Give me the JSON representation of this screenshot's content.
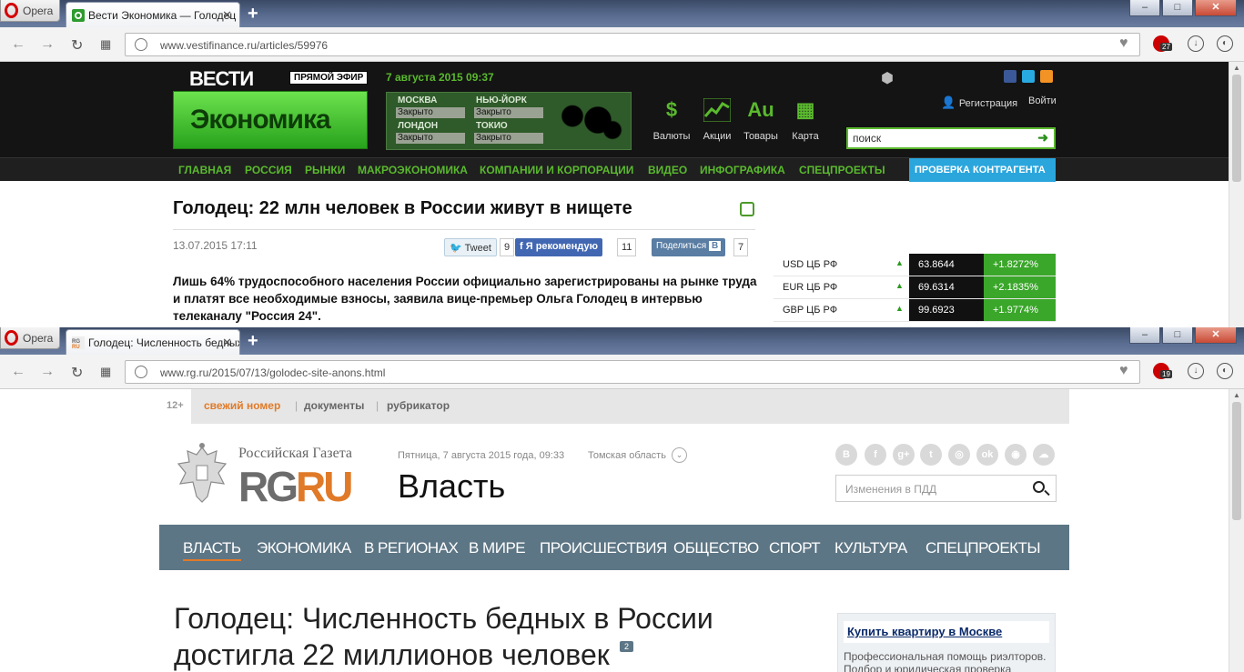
{
  "browser": {
    "menu_label": "Opera",
    "tab_menu": "▾",
    "new_tab": "+",
    "win_min": "–",
    "win_max": "□",
    "win_close": "✕"
  },
  "win1": {
    "tab_title": "Вести Экономика — Голодец",
    "url": "www.vestifinance.ru/articles/59976",
    "ext_badge": "27",
    "favicon_color": "#2e9b2e"
  },
  "win2": {
    "tab_title": "Голодец: Численность бедных",
    "url": "www.rg.ru/2015/07/13/golodec-site-anons.html",
    "ext_badge": "19"
  },
  "vesti": {
    "brand": "ВЕСТИ",
    "live": "ПРЯМОЙ ЭФИР",
    "date": "7 августа 2015 09:37",
    "logo": "Экономика",
    "markets": [
      {
        "city": "МОСКВА",
        "status": "Закрыто"
      },
      {
        "city": "НЬЮ-ЙОРК",
        "status": "Закрыто"
      },
      {
        "city": "ЛОНДОН",
        "status": "Закрыто"
      },
      {
        "city": "ТОКИО",
        "status": "Закрыто"
      }
    ],
    "quick": [
      {
        "icon": "$",
        "label": "Валюты"
      },
      {
        "icon": "📈",
        "label": "Акции"
      },
      {
        "icon": "Au",
        "label": "Товары"
      },
      {
        "icon": "▦",
        "label": "Карта"
      }
    ],
    "register": "Регистрация",
    "login": "Войти",
    "search_placeholder": "поиск",
    "nav": [
      "ГЛАВНАЯ",
      "РОССИЯ",
      "РЫНКИ",
      "МАКРОЭКОНОМИКА",
      "КОМПАНИИ И КОРПОРАЦИИ",
      "ВИДЕО",
      "ИНФОГРАФИКА",
      "СПЕЦПРОЕКТЫ"
    ],
    "check": "ПРОВЕРКА КОНТРАГЕНТА",
    "title": "Голодец: 22 млн человек в России живут в нищете",
    "article_date": "13.07.2015 17:11",
    "share": {
      "tweet": "Tweet",
      "tweet_count": "9",
      "fb": "Я рекомендую",
      "fb_count": "11",
      "vk": "Поделиться",
      "vk_count": "7"
    },
    "lead": "Лишь 64% трудоспособного населения России официально зарегистрированы на рынке труда и платят все необходимые взносы, заявила вице-премьер Ольга Голодец в интервью телеканалу \"Россия 24\".",
    "rates": [
      {
        "name": "USD ЦБ РФ",
        "value": "63.8644",
        "change": "+1.8272%"
      },
      {
        "name": "EUR ЦБ РФ",
        "value": "69.6314",
        "change": "+2.1835%"
      },
      {
        "name": "GBP ЦБ РФ",
        "value": "99.6923",
        "change": "+1.9774%"
      }
    ]
  },
  "rg": {
    "age": "12+",
    "topnav": [
      "свежий номер",
      "документы",
      "рубрикатор"
    ],
    "brand_name": "Российская Газета",
    "logo_rg": "RG",
    "logo_ru": "RU",
    "date": "Пятница, 7 августа 2015 года, 09:33",
    "region": "Томская область",
    "section": "Власть",
    "social": [
      "В",
      "f",
      "g+",
      "t",
      "◎",
      "ok",
      "◉",
      "☁"
    ],
    "search_placeholder": "Изменения в ПДД",
    "nav": [
      "ВЛАСТЬ",
      "ЭКОНОМИКА",
      "В РЕГИОНАХ",
      "В МИРЕ",
      "ПРОИСШЕСТВИЯ",
      "ОБЩЕСТВО",
      "СПОРТ",
      "КУЛЬТУРА",
      "СПЕЦПРОЕКТЫ"
    ],
    "title": "Голодец: Численность бедных в России достигла 22 миллионов человек",
    "comments": "2",
    "ad_title": "Купить квартиру в Москве",
    "ad_text": "Профессиональная помощь риэлторов. Подбор и юридическая проверка"
  }
}
